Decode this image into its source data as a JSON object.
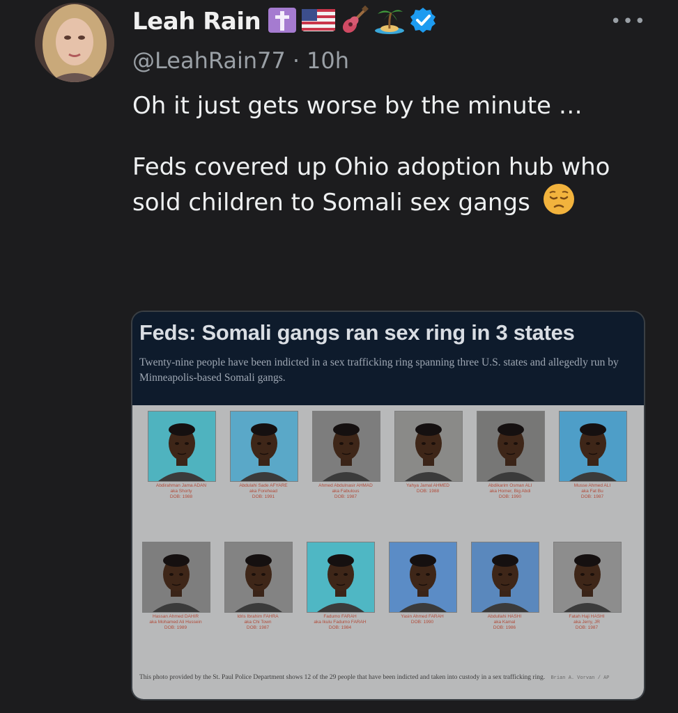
{
  "author": {
    "name": "Leah Rain",
    "handle": "@LeahRain77",
    "separator": "·",
    "time": "10h",
    "name_emojis": [
      "cross-icon",
      "us-flag-icon",
      "guitar-icon",
      "island-icon"
    ],
    "verified": true
  },
  "tweet": {
    "line1": "Oh it just gets worse by the minute …",
    "line2": "Feds covered up Ohio adoption hub who sold children to Somali sex gangs",
    "emoji": "pensive-face-icon"
  },
  "card": {
    "title": "Feds: Somali gangs ran sex ring in 3 states",
    "subtitle": "Twenty-nine people have been indicted in a sex trafficking ring spanning three U.S. states and allegedly run by Minneapolis-based Somali gangs.",
    "mugshots": [
      {
        "name": "Abdirahman Jama ADAN",
        "aka": "aka Shorty",
        "dob": "DOB: 1988",
        "bg": "#4fb3bf"
      },
      {
        "name": "Abdulahi Sade AFYARE",
        "aka": "aka Forehead",
        "dob": "DOB: 1991",
        "bg": "#5aa8c8"
      },
      {
        "name": "Ahmed Abdulnasir AHMAD",
        "aka": "aka Fabulous",
        "dob": "DOB: 1987",
        "bg": "#7d7d7d"
      },
      {
        "name": "Yahya Jamal AHMED",
        "aka": "",
        "dob": "DOB: 1988",
        "bg": "#8a8a88"
      },
      {
        "name": "Abdikarim Osman ALI",
        "aka": "aka Homer, Big Abdi",
        "dob": "DOB: 1990",
        "bg": "#777776"
      },
      {
        "name": "Musse Ahmed ALI",
        "aka": "aka Fat Bu",
        "dob": "DOB: 1987",
        "bg": "#4e9ec8"
      },
      {
        "name": "Hassan Ahmed DAHIR",
        "aka": "aka Mohamed Ali Hussein",
        "dob": "DOB: 1989",
        "bg": "#7e7e7e"
      },
      {
        "name": "Idris Ibrahim FAHRA",
        "aka": "aka Chi Town",
        "dob": "DOB: 1987",
        "bg": "#838383"
      },
      {
        "name": "Fadumo FARAH",
        "aka": "aka Ikulu Fadumo FARAH",
        "dob": "DOB: 1984",
        "bg": "#4fb7c4"
      },
      {
        "name": "Yasin Ahmed FARAH",
        "aka": "",
        "dob": "DOB: 1990",
        "bg": "#5b8cc6"
      },
      {
        "name": "Abdullahi HASHI",
        "aka": "aka Kamal",
        "dob": "DOB: 1986",
        "bg": "#5a88bd"
      },
      {
        "name": "Fatah Haji HASHI",
        "aka": "aka Jerry, JR",
        "dob": "DOB: 1987",
        "bg": "#8d8d8d"
      }
    ],
    "caption": "This photo provided by the St. Paul Police Department shows 12 of the 29 people that have been indicted and taken into custody in a sex trafficking ring.",
    "credit": "Brian A. Vorvan / AP"
  },
  "colors": {
    "background": "#1c1c1e",
    "verified": "#1d9bf0",
    "card_header": "#0e1b2c",
    "label_red": "#b14a38"
  }
}
